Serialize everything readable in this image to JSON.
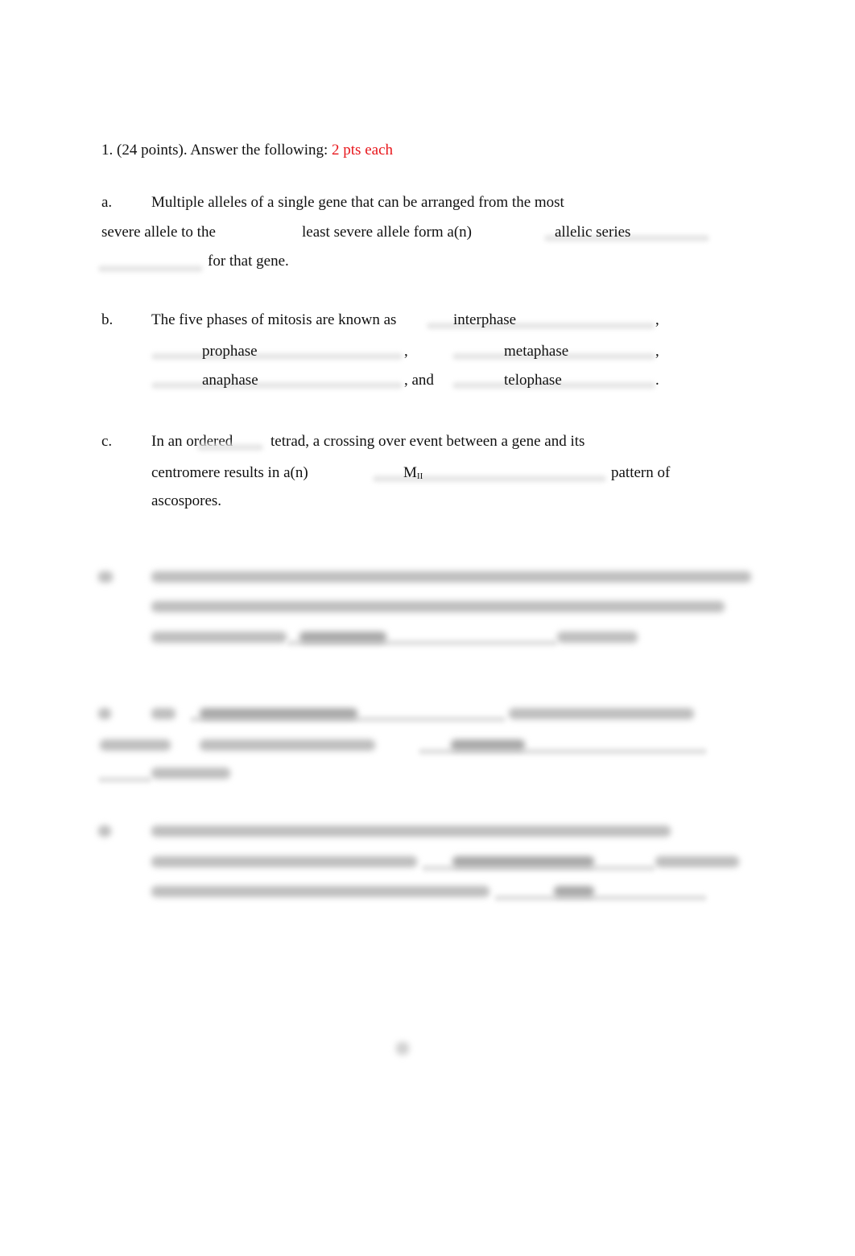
{
  "question": {
    "number_label": "1. (24 points). Answer the following:",
    "points_note": "2 pts each",
    "points_note_color": "#e8151a"
  },
  "items": {
    "a": {
      "label": "a.",
      "line1": "Multiple alleles of a single gene that can be arranged from the most",
      "line2_start": "severe allele to the",
      "line2_mid": "least severe allele form a(n)",
      "answer": "allelic series",
      "line3_end": "for that gene."
    },
    "b": {
      "label": "b.",
      "line1": "The five phases of mitosis are known as",
      "answers": [
        "interphase",
        "prophase",
        "metaphase",
        "anaphase",
        "telophase"
      ],
      "comma": ",",
      "and_text": ",  and",
      "period": "."
    },
    "c": {
      "label": "c.",
      "line1_start": "In an ordered",
      "line1_end": "tetrad, a crossing over event between a gene and its",
      "line2_start": "centromere results in a(n)",
      "answer_main": "M",
      "answer_sub": "II",
      "line2_end": "pattern of",
      "line3": "ascospores."
    },
    "d": {
      "label": "d.",
      "blurred": true
    },
    "e": {
      "label": "e.",
      "blurred": true
    },
    "f": {
      "label": "f.",
      "blurred": true
    }
  },
  "page_number": "1"
}
